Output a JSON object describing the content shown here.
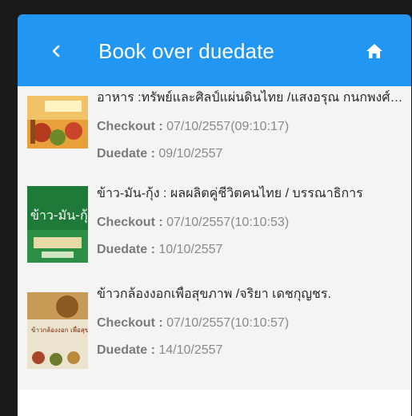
{
  "header": {
    "title": "Book over duedate",
    "back_icon": "chevron-left-icon",
    "home_icon": "home-icon",
    "color": "#2196f3"
  },
  "books": [
    {
      "title": "อาหาร :ทรัพย์และศิลป์แผ่นดินไทย /แสงอรุณ กนกพงศ์ชัย",
      "checkout_label": "Checkout :",
      "checkout": "07/10/2557(09:10:17)",
      "duedate_label": "Duedate :",
      "duedate": "09/10/2557"
    },
    {
      "title": "ข้าว-มัน-กุ้ง : ผลผลิตคู่ชีวิตคนไทย / บรรณาธิการ",
      "cover_text": "ข้าว-มัน-กุ้ง",
      "checkout_label": "Checkout :",
      "checkout": "07/10/2557(10:10:53)",
      "duedate_label": "Duedate :",
      "duedate": "10/10/2557"
    },
    {
      "title": "ข้าวกล้องงอกเพื่อสุขภาพ /จริยา เดชกุญชร.",
      "cover_text": "ข้าวกล้องงอก เพื่อสุขภาพ",
      "checkout_label": "Checkout :",
      "checkout": "07/10/2557(10:10:57)",
      "duedate_label": "Duedate :",
      "duedate": "14/10/2557"
    }
  ]
}
